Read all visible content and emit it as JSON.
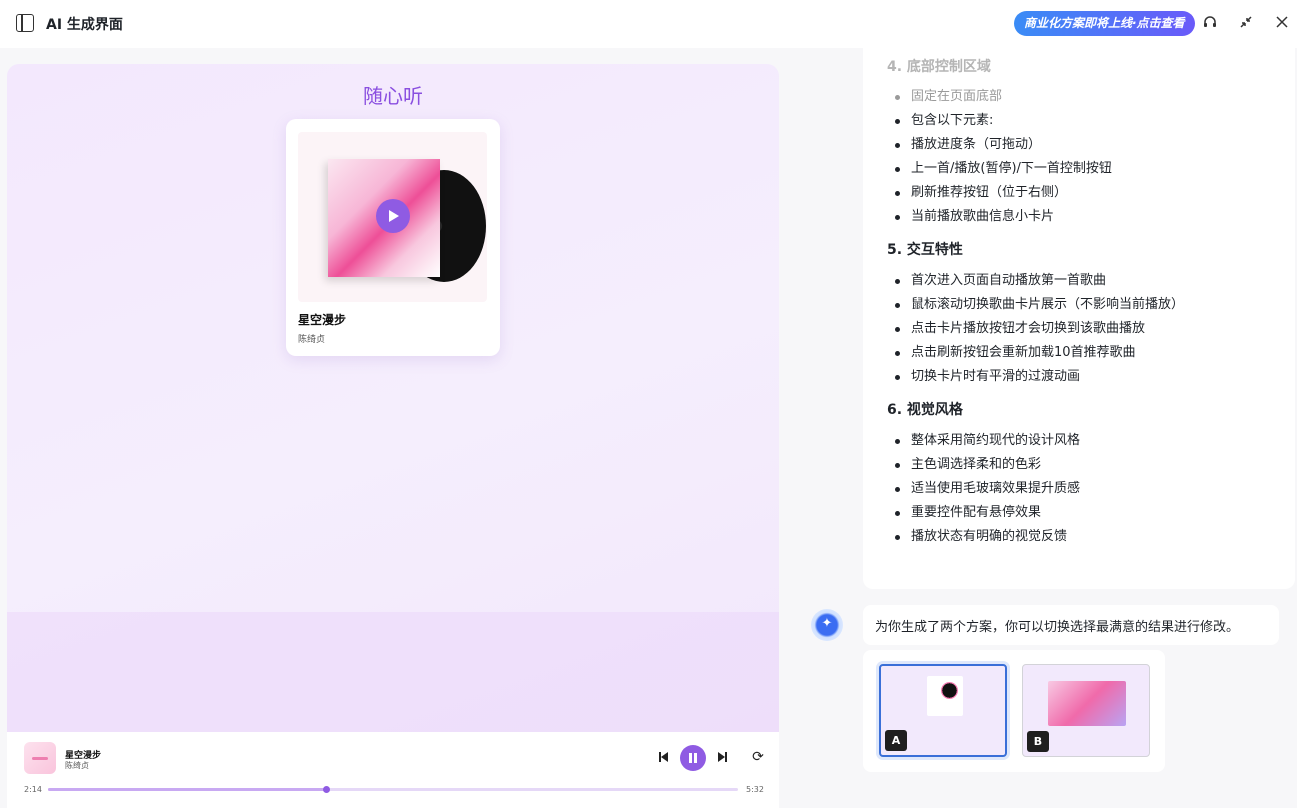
{
  "header": {
    "title": "AI 生成界面",
    "promo_label": "商业化方案即将上线·点击查看",
    "icons": [
      "sidebar-toggle-icon",
      "headset-icon",
      "collapse-icon",
      "close-icon"
    ]
  },
  "preview": {
    "app_title": "随心听",
    "card": {
      "song_name": "星空漫步",
      "artist": "陈绮贞"
    },
    "player": {
      "song_name": "星空漫步",
      "artist": "陈绮贞",
      "current_time": "2:14",
      "total_time": "5:32",
      "progress": 0.403
    }
  },
  "spec": {
    "sections": [
      {
        "heading": "4. 底部控制区域",
        "items": [
          "固定在页面底部",
          "包含以下元素:",
          "播放进度条（可拖动）",
          "上一首/播放(暂停)/下一首控制按钮",
          "刷新推荐按钮（位于右侧）",
          "当前播放歌曲信息小卡片"
        ]
      },
      {
        "heading": "5. 交互特性",
        "items": [
          "首次进入页面自动播放第一首歌曲",
          "鼠标滚动切换歌曲卡片展示（不影响当前播放）",
          "点击卡片播放按钮才会切换到该歌曲播放",
          "点击刷新按钮会重新加载10首推荐歌曲",
          "切换卡片时有平滑的过渡动画"
        ]
      },
      {
        "heading": "6. 视觉风格",
        "items": [
          "整体采用简约现代的设计风格",
          "主色调选择柔和的色彩",
          "适当使用毛玻璃效果提升质感",
          "重要控件配有悬停效果",
          "播放状态有明确的视觉反馈"
        ]
      }
    ]
  },
  "chat": {
    "message": "为你生成了两个方案，你可以切换选择最满意的结果进行修改。",
    "options": [
      {
        "label": "A",
        "selected": true
      },
      {
        "label": "B",
        "selected": false
      }
    ]
  },
  "colors": {
    "accent": "#8f5be3",
    "selection": "#3a6fd8",
    "promo_start": "#3a8cf6",
    "promo_end": "#6a5af9"
  }
}
